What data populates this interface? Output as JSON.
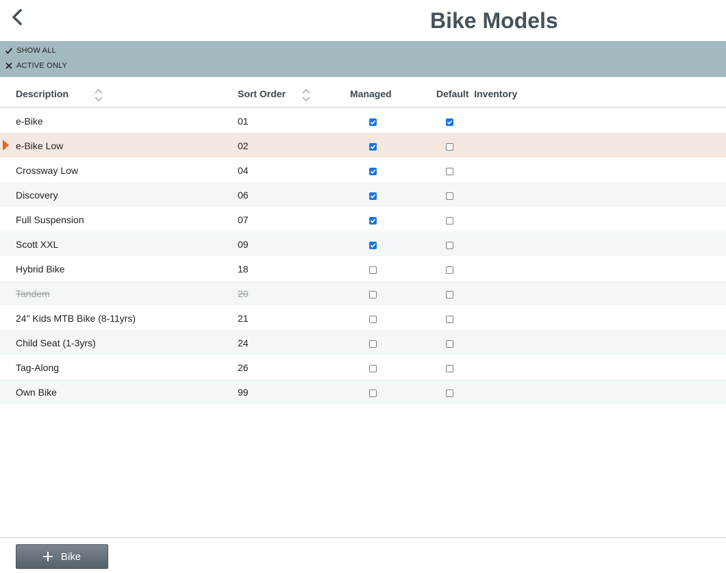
{
  "header": {
    "title": "Bike Models"
  },
  "filters": {
    "show_all": "SHOW ALL",
    "active_only": "ACTIVE ONLY"
  },
  "columns": {
    "description": "Description",
    "sort_order": "Sort Order",
    "managed": "Managed",
    "default_inventory": "Default  Inventory"
  },
  "rows": [
    {
      "description": "e-Bike",
      "sort_order": "01",
      "managed": true,
      "default_inventory": true,
      "active": true
    },
    {
      "description": "e-Bike Low",
      "sort_order": "02",
      "managed": true,
      "default_inventory": false,
      "active": true,
      "selected": true
    },
    {
      "description": "Crossway Low",
      "sort_order": "04",
      "managed": true,
      "default_inventory": false,
      "active": true
    },
    {
      "description": "Discovery",
      "sort_order": "06",
      "managed": true,
      "default_inventory": false,
      "active": true
    },
    {
      "description": "Full Suspension",
      "sort_order": "07",
      "managed": true,
      "default_inventory": false,
      "active": true
    },
    {
      "description": "Scott XXL",
      "sort_order": "09",
      "managed": true,
      "default_inventory": false,
      "active": true
    },
    {
      "description": "Hybrid Bike",
      "sort_order": "18",
      "managed": false,
      "default_inventory": false,
      "active": true
    },
    {
      "description": "Tandem",
      "sort_order": "20",
      "managed": false,
      "default_inventory": false,
      "active": false
    },
    {
      "description": "24\" Kids MTB Bike (8-11yrs)",
      "sort_order": "21",
      "managed": false,
      "default_inventory": false,
      "active": true
    },
    {
      "description": "Child Seat (1-3yrs)",
      "sort_order": "24",
      "managed": false,
      "default_inventory": false,
      "active": true
    },
    {
      "description": "Tag-Along",
      "sort_order": "26",
      "managed": false,
      "default_inventory": false,
      "active": true
    },
    {
      "description": "Own Bike",
      "sort_order": "99",
      "managed": false,
      "default_inventory": false,
      "active": true
    }
  ],
  "footer": {
    "add_label": "Bike"
  },
  "colors": {
    "filter_bar": "#a2b9bd",
    "selected_row": "#f5e8e1",
    "alt_row": "#f3f7f7",
    "marker": "#e8651f",
    "checkbox_on": "#1a73e8",
    "title": "#46525a"
  },
  "icons": {
    "back": "chevron-left-icon",
    "show_all": "checkmark-icon",
    "active_only": "x-mark-icon",
    "sort": "sort-up-down-icon",
    "add": "plus-icon"
  }
}
